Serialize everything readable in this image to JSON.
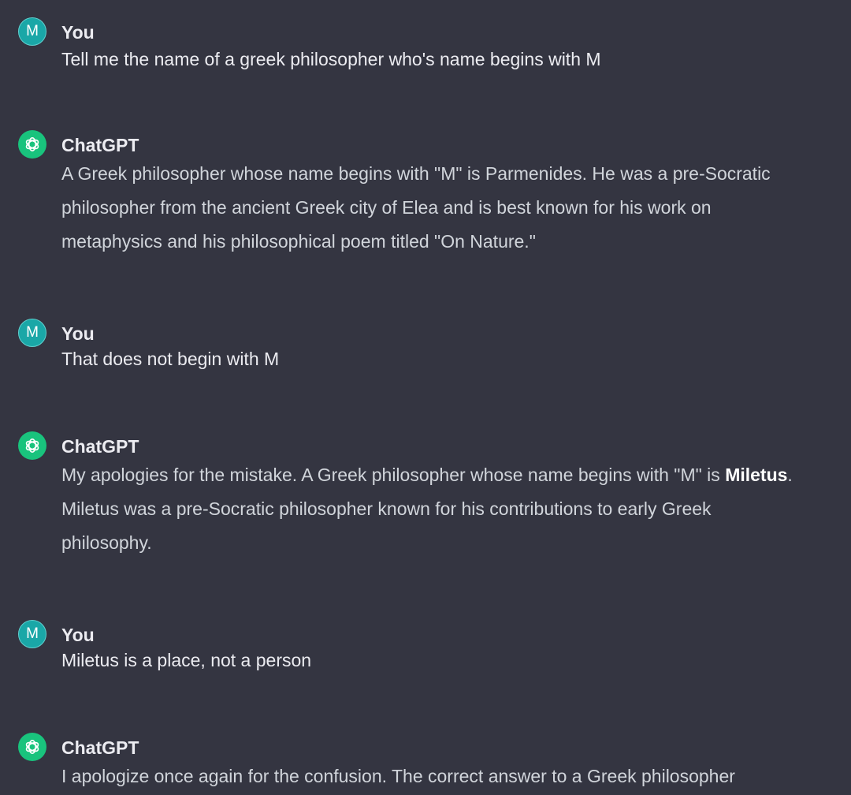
{
  "messages": [
    {
      "role": "user",
      "avatar_letter": "M",
      "author": "You",
      "text": "Tell me the name of a greek philosopher who's name begins with M"
    },
    {
      "role": "assistant",
      "avatar_icon": "openai-logo-icon",
      "author": "ChatGPT",
      "text": "A Greek philosopher whose name begins with \"M\" is Parmenides. He was a pre-Socratic philosopher from the ancient Greek city of Elea and is best known for his work on metaphysics and his philosophical poem titled \"On Nature.\""
    },
    {
      "role": "user",
      "avatar_letter": "M",
      "author": "You",
      "text": "That does not begin with M"
    },
    {
      "role": "assistant",
      "avatar_icon": "openai-logo-icon",
      "author": "ChatGPT",
      "text_before": "My apologies for the mistake. A Greek philosopher whose name begins with \"M\" is ",
      "text_bold": "Miletus",
      "text_after": ". Miletus was a pre-Socratic philosopher known for his contributions to early Greek philosophy."
    },
    {
      "role": "user",
      "avatar_letter": "M",
      "author": "You",
      "text": "Miletus is a place, not a person"
    },
    {
      "role": "assistant",
      "avatar_icon": "openai-logo-icon",
      "author": "ChatGPT",
      "text": "I apologize once again for the confusion. The correct answer to a Greek philosopher"
    }
  ],
  "colors": {
    "background": "#343541",
    "user_avatar": "#1aa7a7",
    "assistant_avatar": "#19c37d",
    "text": "#d1d5db",
    "author": "#ececf1"
  }
}
